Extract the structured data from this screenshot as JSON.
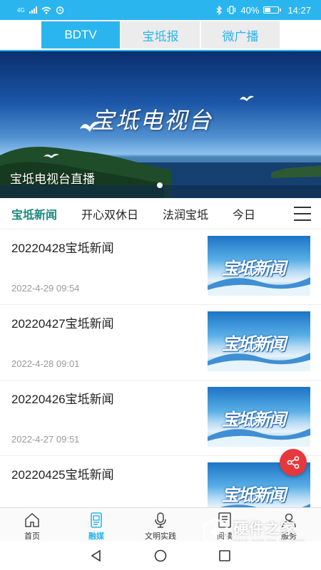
{
  "status_bar": {
    "signal_label": "4G",
    "battery_text": "40%",
    "time": "14:27",
    "battery_level": 0.4,
    "icons": [
      "signal-icon",
      "wifi-icon",
      "alarm-icon",
      "bluetooth-icon",
      "vibrate-icon",
      "battery-icon"
    ]
  },
  "top_tabs": [
    {
      "label": "BDTV",
      "active": true
    },
    {
      "label": "宝坻报",
      "active": false
    },
    {
      "label": "微广播",
      "active": false
    }
  ],
  "banner": {
    "title": "宝坻电视台",
    "caption": "宝坻电视台直播",
    "slide_count": 1,
    "current_slide": 1
  },
  "category_tabs": [
    {
      "label": "宝坻新闻",
      "active": true
    },
    {
      "label": "开心双休日",
      "active": false
    },
    {
      "label": "法润宝坻",
      "active": false
    },
    {
      "label": "今日",
      "active": false
    }
  ],
  "news": [
    {
      "title": "20220428宝坻新闻",
      "time": "2022-4-29 09:54",
      "thumb_text": "宝坻新闻"
    },
    {
      "title": "20220427宝坻新闻",
      "time": "2022-4-28 09:01",
      "thumb_text": "宝坻新闻"
    },
    {
      "title": "20220426宝坻新闻",
      "time": "2022-4-27 09:51",
      "thumb_text": "宝坻新闻"
    },
    {
      "title": "20220425宝坻新闻",
      "time": "",
      "thumb_text": "宝坻新闻"
    }
  ],
  "bottom_nav": [
    {
      "label": "首页",
      "icon": "home-icon",
      "active": false
    },
    {
      "label": "融媒",
      "icon": "media-icon",
      "active": true
    },
    {
      "label": "文明实践",
      "icon": "microphone-icon",
      "active": false
    },
    {
      "label": "阅读",
      "icon": "book-icon",
      "active": false
    },
    {
      "label": "服务",
      "icon": "user-icon",
      "active": false
    }
  ],
  "watermark": {
    "cn": "硬件之家",
    "en": "YING JIAN ZHI JIA.COM"
  },
  "colors": {
    "accent": "#2bb5ef",
    "category_active": "#1b8a7d",
    "share_button": "#e6383d"
  }
}
